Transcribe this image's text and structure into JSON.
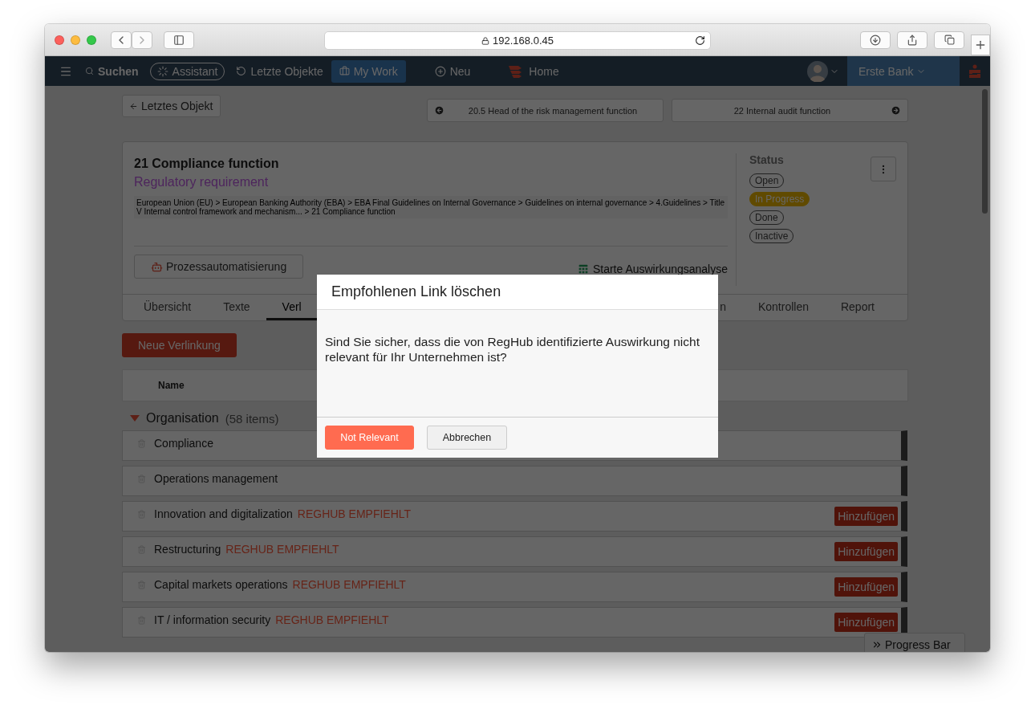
{
  "browser": {
    "url": "192.168.0.45"
  },
  "nav": {
    "items": [
      {
        "kind": "menu",
        "selected": false
      },
      {
        "kind": "search",
        "label": "Suchen",
        "selected": false
      },
      {
        "kind": "assistant",
        "label": "Assistant",
        "selected": false
      },
      {
        "kind": "history",
        "label": "Letzte Objekte",
        "selected": false
      },
      {
        "kind": "work",
        "label": "My Work",
        "selected": true
      },
      {
        "kind": "new",
        "label": "Neu",
        "selected": false
      },
      {
        "kind": "home",
        "label": "Home",
        "selected": false
      }
    ],
    "org": "Erste Bank"
  },
  "back_button": "Letztes Objekt",
  "prev_link": "20.5 Head of the risk management function",
  "next_link": "22 Internal audit function",
  "record": {
    "title": "21 Compliance function",
    "type": "Regulatory requirement",
    "breadcrumb": "European Union (EU)  >  European Banking Authority (EBA)  >  EBA Final Guidelines on Internal Governance  >  Guidelines on internal governance  >  4.Guidelines  >  Title V Internal control framework and mechanism...  >  21 Compliance function",
    "automation_button": "Prozessautomatisierung",
    "analysis_link": "Starte Auswirkungsanalyse",
    "status": {
      "label": "Status",
      "options": [
        {
          "label": "Open",
          "selected": false
        },
        {
          "label": "In Progress",
          "selected": true
        },
        {
          "label": "Done",
          "selected": false
        },
        {
          "label": "Inactive",
          "selected": false
        }
      ]
    }
  },
  "tabs": [
    {
      "label": "Übersicht",
      "selected": false
    },
    {
      "label": "Texte",
      "selected": false
    },
    {
      "label": "Verl",
      "selected": true
    },
    {
      "label": "n",
      "selected": false
    },
    {
      "label": "Kontrollen",
      "selected": false
    },
    {
      "label": "Report",
      "selected": false
    }
  ],
  "new_link_button": "Neue Verlinkung",
  "table": {
    "columns": [
      "Name"
    ],
    "group": {
      "label": "Organisation",
      "count": "(58 items)",
      "expanded": true,
      "rows": [
        {
          "name": "Compliance"
        },
        {
          "name": "Operations management"
        },
        {
          "name": "Innovation and digitalization",
          "tag": "REGHUB EMPFIEHLT",
          "action": "Hinzufügen"
        },
        {
          "name": "Restructuring",
          "tag": "REGHUB EMPFIEHLT",
          "action": "Hinzufügen"
        },
        {
          "name": "Capital markets operations",
          "tag": "REGHUB EMPFIEHLT",
          "action": "Hinzufügen"
        },
        {
          "name": "IT / information security",
          "tag": "REGHUB EMPFIEHLT",
          "action": "Hinzufügen"
        }
      ]
    }
  },
  "progress_button": "Progress Bar",
  "dialog": {
    "title": "Empfohlenen Link löschen",
    "message": "Sind Sie sicher, dass die von RegHub identifizierte Auswirkung nicht relevant für Ihr Unternehmen ist?",
    "buttons": [
      {
        "label": "Not Relevant",
        "kind": "primary"
      },
      {
        "label": "Abbrechen",
        "kind": "secondary"
      }
    ]
  }
}
